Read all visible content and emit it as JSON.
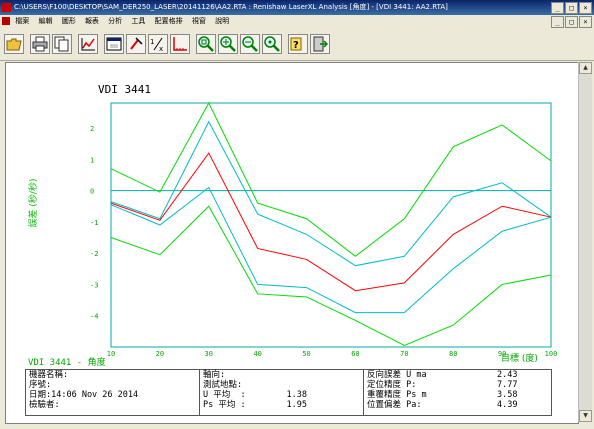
{
  "window": {
    "title": "C:\\USERS\\F100\\DESKTOP\\SAM_DER250_LASER\\20141126\\AA2.RTA : Renishaw LaserXL Analysis [角度] - [VDI 3441: AA2.RTA]"
  },
  "menu": {
    "items": [
      "檔案",
      "編輯",
      "圖形",
      "報表",
      "分析",
      "工具",
      "配置格排",
      "視窗",
      "說明"
    ]
  },
  "toolbar": {
    "buttons": [
      "open-icon",
      "print-icon",
      "copy-icon",
      "graph-icon",
      "window-icon",
      "marker-icon",
      "fraction-icon",
      "axis-icon",
      "zoom-fit-icon",
      "zoom-in-icon",
      "zoom-out-icon",
      "zoom-reset-icon",
      "help-icon",
      "exit-icon"
    ]
  },
  "chart_data": {
    "type": "line",
    "title": "VDI 3441",
    "xlabel": "目標 (度)",
    "ylabel": "誤差 (秒/秒)",
    "x": [
      10,
      20,
      30,
      40,
      50,
      60,
      70,
      80,
      90,
      100
    ],
    "xticks": [
      "10",
      "20",
      "30",
      "40",
      "50",
      "60",
      "70",
      "80",
      "90",
      "100"
    ],
    "yticks": [
      "2",
      "1",
      "0",
      "-1",
      "-2",
      "-3",
      "-4"
    ],
    "xlim": [
      10,
      100
    ],
    "ylim": [
      -5,
      2.8
    ],
    "zero_line": 0,
    "series": [
      {
        "values": [
          0.7,
          -0.05,
          2.8,
          -0.4,
          -0.9,
          -2.1,
          -0.9,
          1.4,
          2.1,
          0.95
        ],
        "color": "#00dd00"
      },
      {
        "values": [
          -0.35,
          -0.9,
          2.2,
          -0.75,
          -1.4,
          -2.4,
          -2.1,
          -0.2,
          0.25,
          -0.85
        ],
        "color": "#00bbcc"
      },
      {
        "values": [
          -0.4,
          -0.95,
          1.2,
          -1.85,
          -2.2,
          -3.2,
          -2.95,
          -1.4,
          -0.5,
          -0.85
        ],
        "color": "#ff0000"
      },
      {
        "values": [
          -0.45,
          -1.1,
          0.1,
          -3.0,
          -3.1,
          -3.9,
          -3.9,
          -2.5,
          -1.3,
          -0.85
        ],
        "color": "#00bbcc"
      },
      {
        "values": [
          -1.5,
          -2.05,
          -0.5,
          -3.3,
          -3.4,
          -4.15,
          -4.95,
          -4.3,
          -3.0,
          -2.7
        ],
        "color": "#00dd00"
      }
    ]
  },
  "caption": "VDI 3441 - 角度",
  "info": {
    "left": [
      "機器名稱:",
      "序號:",
      "日期:14:06 Nov 26 2014",
      "檢驗者:"
    ],
    "middle": [
      "軸向:",
      "測試地點:",
      "U 平均  :        1.38",
      "Ps 平均 :        1.95"
    ],
    "right_labels": [
      "反向誤差 U ma",
      "定位精度 P:",
      "重覆精度 Ps m",
      "位置偏差 Pa:"
    ],
    "right_values": [
      "2.43",
      "7.77",
      "3.58",
      "4.39"
    ]
  },
  "colors": {
    "axis": "#00aaaa",
    "label": "#00bb00",
    "tick": "#00aa00"
  }
}
